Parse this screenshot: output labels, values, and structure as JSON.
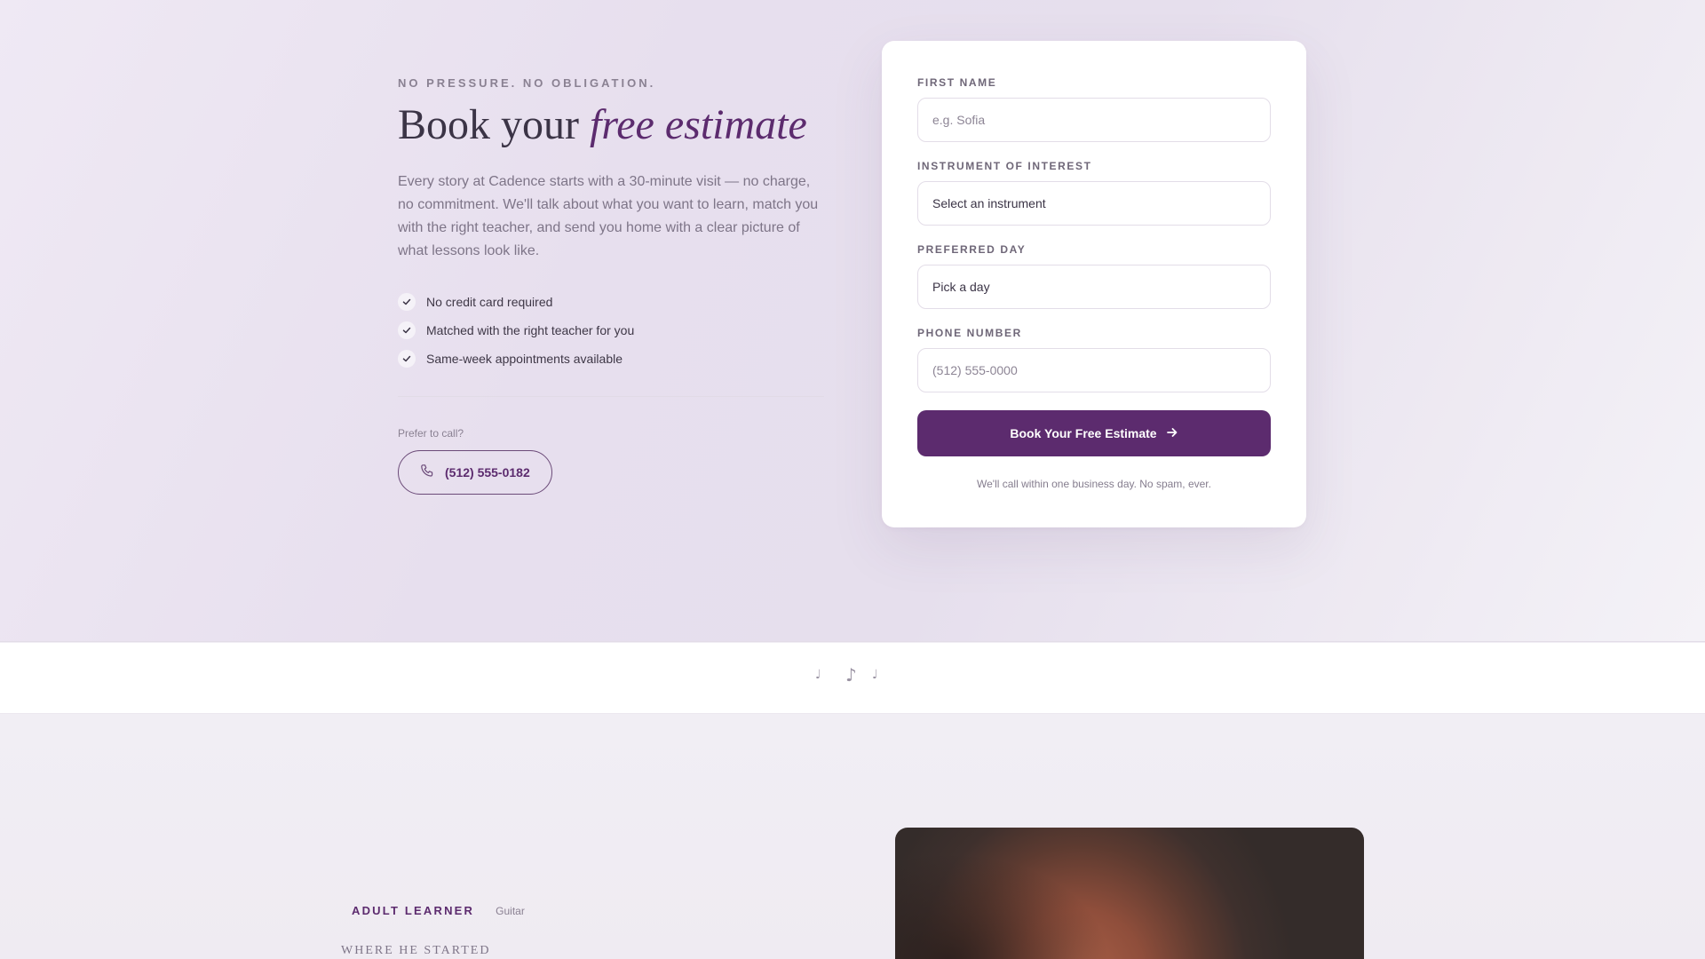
{
  "hero": {
    "eyebrow": "NO PRESSURE. NO OBLIGATION.",
    "title_main": "Book your",
    "title_accent": "free estimate",
    "description": "Every story at Cadence starts with a 30-minute visit — no charge, no commitment. We'll talk about what you want to learn, match you with the right teacher, and send you home with a clear picture of what lessons look like.",
    "benefits": [
      "No credit card required",
      "Matched with the right teacher for you",
      "Same-week appointments available"
    ],
    "call_label": "Prefer to call?",
    "phone": "(512) 555-0182"
  },
  "form": {
    "first_name": {
      "label": "FIRST NAME",
      "placeholder": "e.g. Sofia",
      "value": ""
    },
    "instrument": {
      "label": "INSTRUMENT OF INTEREST",
      "selected": "Select an instrument"
    },
    "day": {
      "label": "PREFERRED DAY",
      "selected": "Pick a day"
    },
    "phone": {
      "label": "PHONE NUMBER",
      "placeholder": "(512) 555-0000",
      "value": ""
    },
    "submit_label": "Book Your Free Estimate",
    "fineprint": "We'll call within one business day. No spam, ever."
  },
  "divider_notes": [
    "♩",
    "♪",
    "♩"
  ],
  "story": {
    "tag": "ADULT LEARNER",
    "instrument": "Guitar",
    "subheading": "WHERE HE STARTED"
  },
  "icons": {
    "check": "check-icon",
    "phone": "phone-icon",
    "arrow": "arrow-right-icon",
    "chevron": "chevron-down-icon"
  },
  "colors": {
    "brand": "#5c2b6e",
    "text": "#3b3446",
    "muted": "#7e7588",
    "card": "#ffffff"
  }
}
